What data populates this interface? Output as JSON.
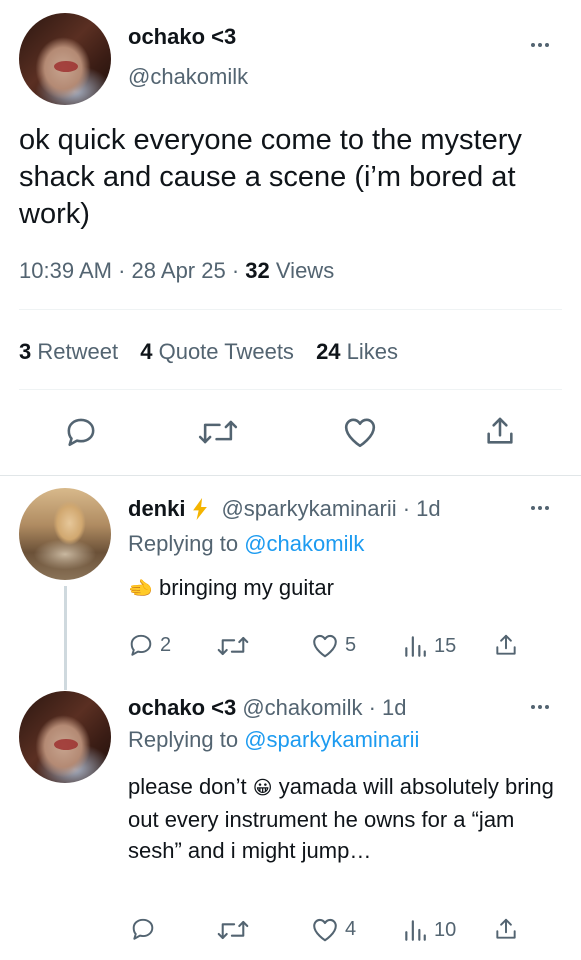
{
  "main_tweet": {
    "display_name": "ochako <3",
    "handle": "@chakomilk",
    "text": "ok quick everyone come to the mystery shack and cause a scene (i’m bored at work)",
    "time": "10:39 AM",
    "sep1": "·",
    "date": "28 Apr 25",
    "sep2": "·",
    "views_count": "32",
    "views_label": "Views",
    "retweets_count": "3",
    "retweets_label": "Retweet",
    "quotes_count": "4",
    "quotes_label": "Quote Tweets",
    "likes_count": "24",
    "likes_label": "Likes"
  },
  "replies": [
    {
      "display_name": "denki",
      "handle_meta": "@sparkykaminarii · 1d",
      "replying_prefix": "Replying to",
      "replying_to": "@chakomilk",
      "emoji": "🫲",
      "text": "bringing my guitar",
      "reply_count": "2",
      "like_count": "5",
      "view_count": "15"
    },
    {
      "display_name": "ochako <3",
      "handle_meta": "@chakomilk · 1d",
      "replying_prefix": "Replying to",
      "replying_to": "@sparkykaminarii",
      "text_part1": "please don’t",
      "emoji": "😀",
      "text_part2": "yamada will",
      "text_rest": "absolutely bring out every instrument he owns for a “jam sesh” and i might jump…",
      "like_count": "4",
      "view_count": "10"
    }
  ],
  "colors": {
    "text": "#0f1419",
    "muted": "#536471",
    "link": "#1d9bf0",
    "lightning": "#f4b400"
  },
  "icons": [
    "reply-icon",
    "retweet-icon",
    "like-icon",
    "share-icon",
    "views-icon",
    "lightning-icon",
    "more-icon"
  ]
}
